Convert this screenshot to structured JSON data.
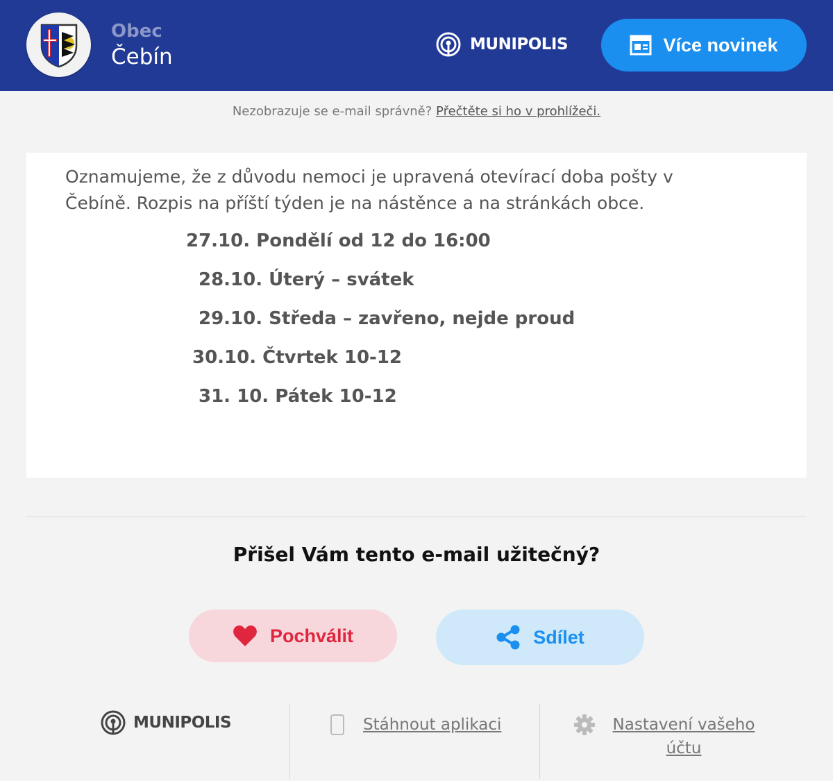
{
  "header": {
    "org_type": "Obec",
    "org_name": "Čebín",
    "brand": "MUNIPOLIS",
    "more_news_label": "Více novinek"
  },
  "notice": {
    "text": "Nezobrazuje se e-mail správně?",
    "link": "Přečtěte si ho v prohlížeči."
  },
  "message": {
    "intro": "Oznamujeme, že z důvodu nemoci je upravená otevírací doba pošty v Čebíně. Rozpis na příští týden je na nástěnce a na stránkách obce.",
    "schedule": [
      "27.10. Pondělí od 12 do 16:00",
      "28.10. Úterý – svátek",
      "29.10. Středa – zavřeno, nejde proud",
      "30.10. Čtvrtek 10-12",
      "31. 10. Pátek 10-12"
    ]
  },
  "feedback": {
    "question": "Přišel Vám tento e-mail užitečný?",
    "praise_label": "Pochválit",
    "share_label": "Sdílet"
  },
  "footer": {
    "brand": "MUNIPOLIS",
    "download_app": "Stáhnout aplikaci",
    "account_settings": "Nastavení vašeho účtu"
  },
  "colors": {
    "header_bg": "#213a96",
    "accent_blue": "#1a8ff0",
    "praise_red": "#e0263e"
  }
}
